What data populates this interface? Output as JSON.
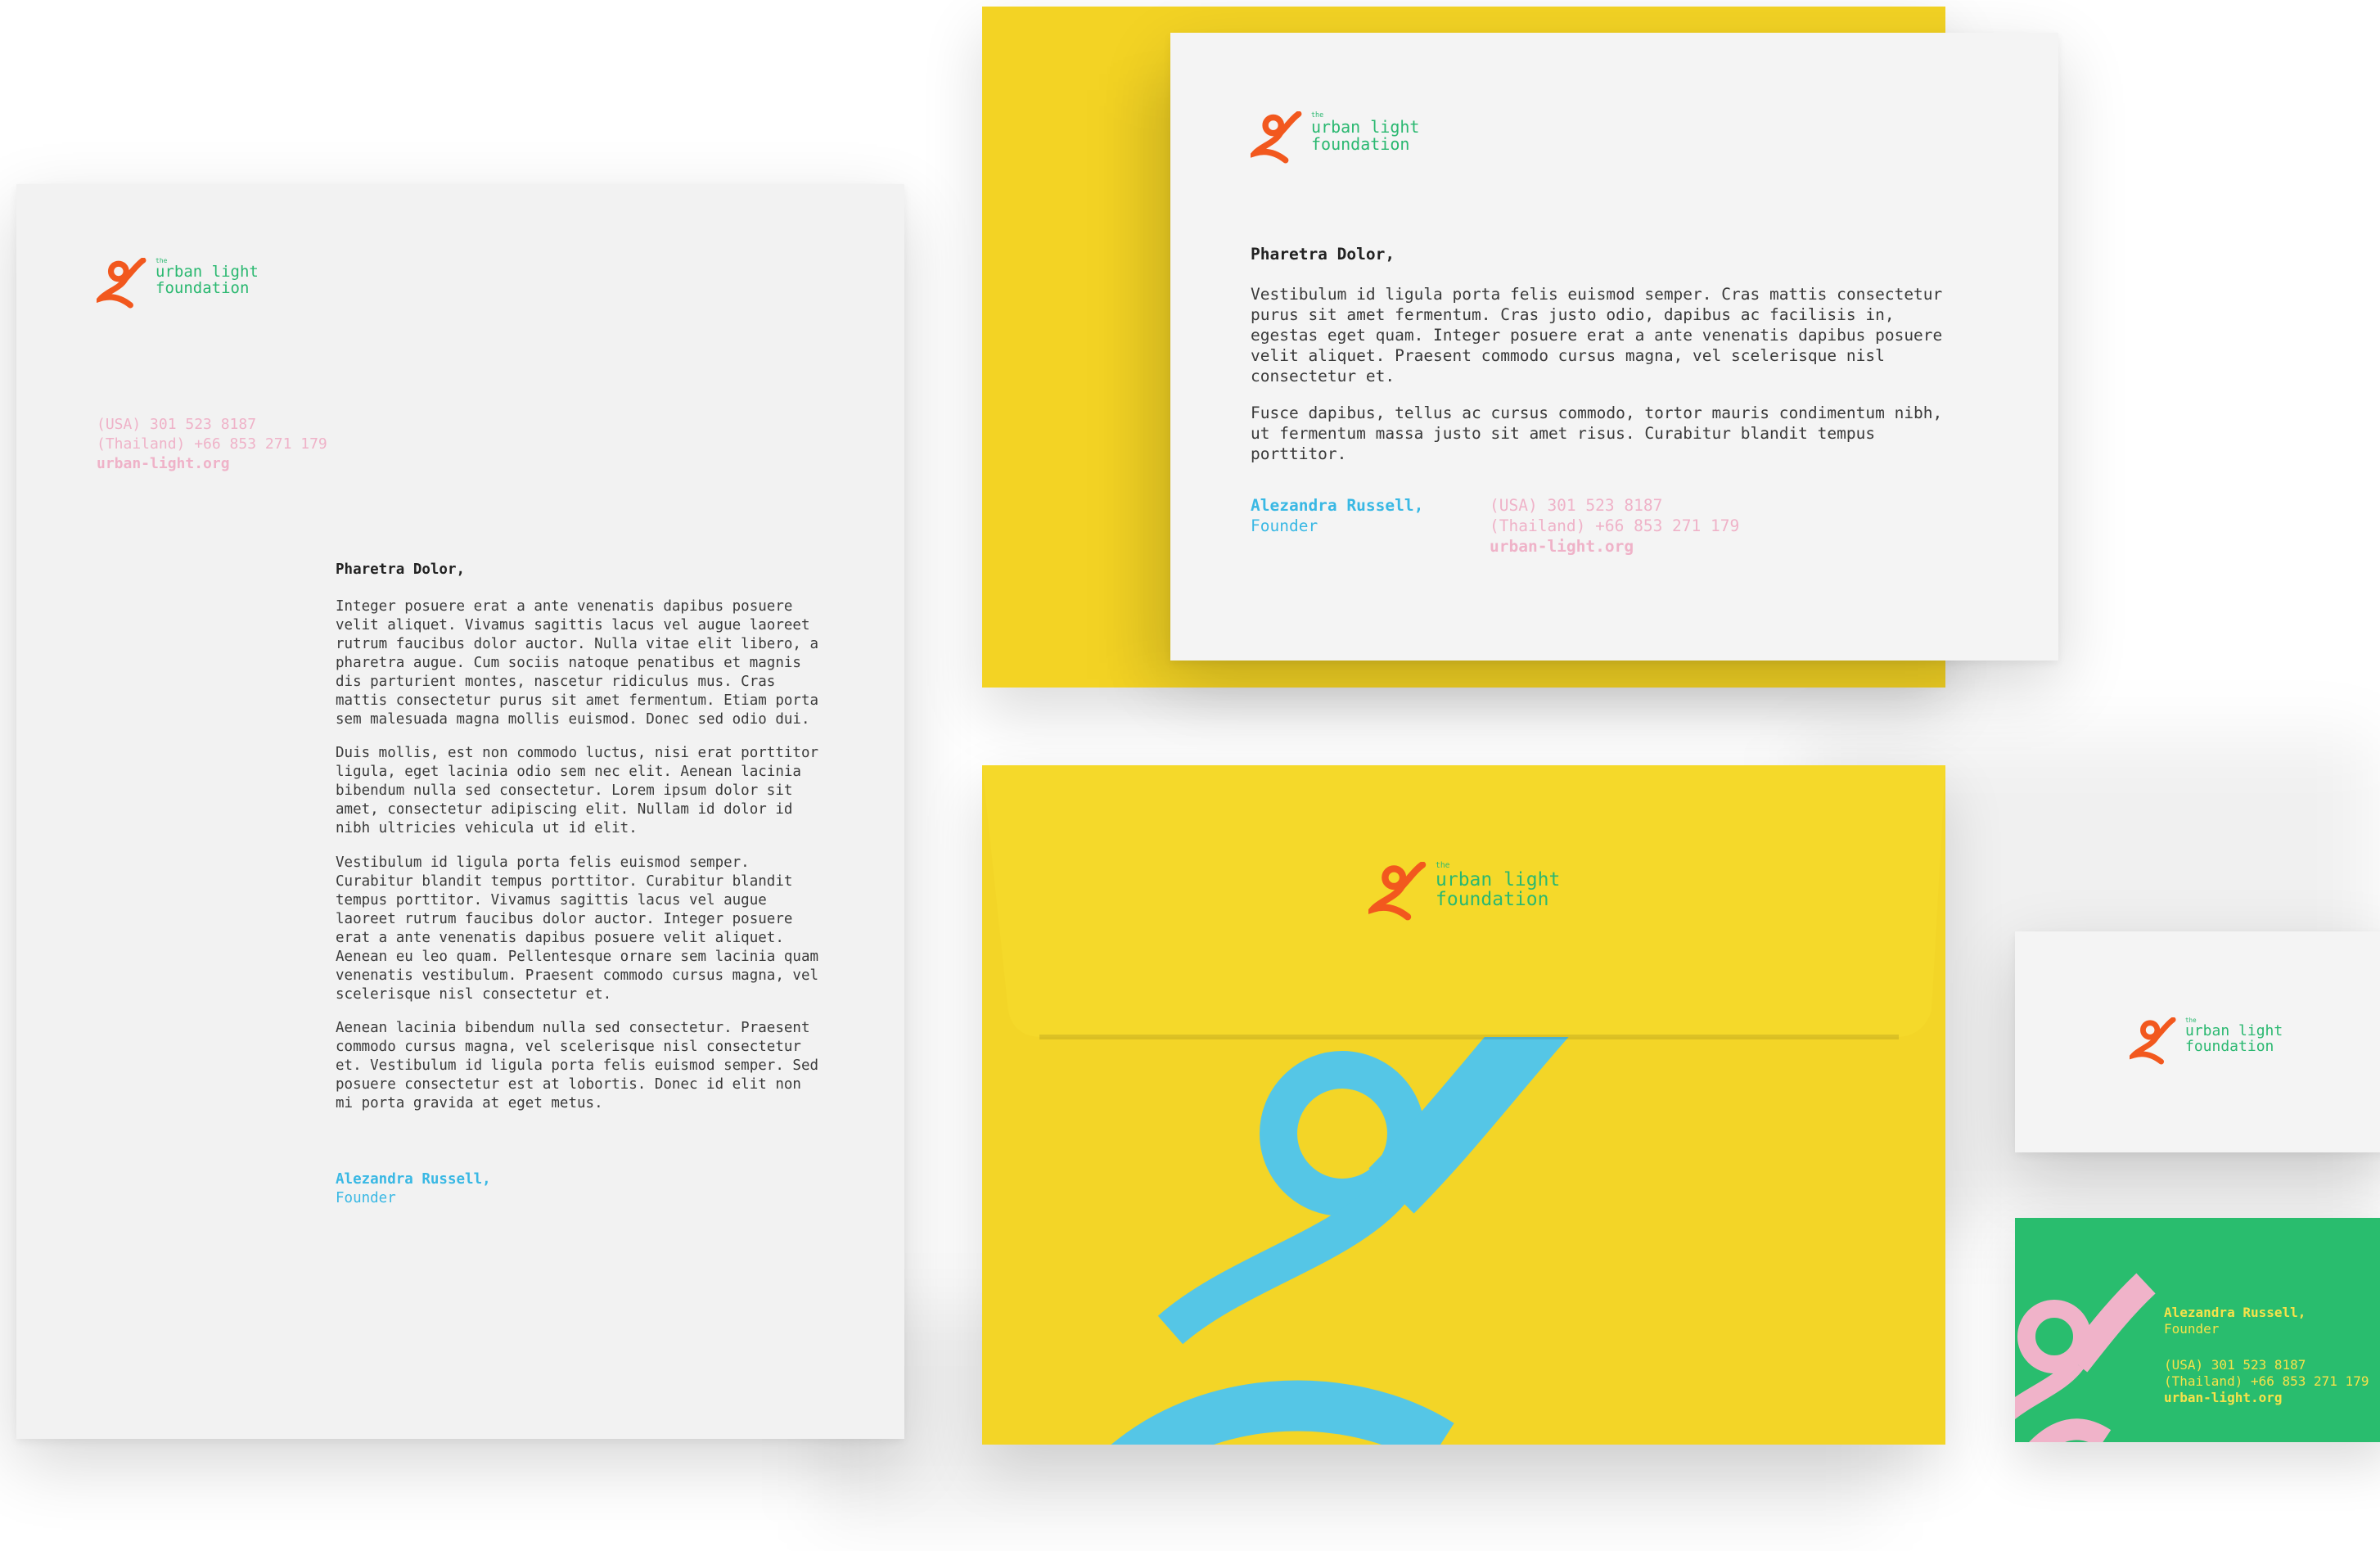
{
  "brand": {
    "the": "the",
    "line1": "urban light",
    "line2": "foundation",
    "colors": {
      "orange": "#f2581e",
      "green": "#2ab870",
      "yellow": "#f5d928",
      "sky": "#55c6e6",
      "pink": "#f0b3c9",
      "card_green": "#29bd6e"
    },
    "mark_icon": "running-figure-logo-icon"
  },
  "contact": {
    "usa": "(USA) 301 523 8187",
    "thailand": "(Thailand) +66 853 271 179",
    "web": "urban-light.org"
  },
  "letterhead": {
    "salutation": "Pharetra Dolor,",
    "paragraphs": [
      "Integer posuere erat a ante venenatis dapibus posuere velit aliquet. Vivamus sagittis lacus vel augue laoreet rutrum faucibus dolor auctor. Nulla vitae elit libero, a pharetra augue. Cum sociis natoque penatibus et magnis dis parturient montes, nascetur ridiculus mus. Cras mattis consectetur purus sit amet fermentum. Etiam porta sem malesuada magna mollis euismod. Donec sed odio dui.",
      "Duis mollis, est non commodo luctus, nisi erat porttitor ligula, eget lacinia odio sem nec elit. Aenean lacinia bibendum nulla sed consectetur. Lorem ipsum dolor sit amet, consectetur adipiscing elit. Nullam id dolor id nibh ultricies vehicula ut id elit.",
      "Vestibulum id ligula porta felis euismod semper. Curabitur blandit tempus porttitor. Curabitur blandit tempus porttitor. Vivamus sagittis lacus vel augue laoreet rutrum faucibus dolor auctor. Integer posuere erat a ante venenatis dapibus posuere velit aliquet. Aenean eu leo quam. Pellentesque ornare sem lacinia quam venenatis vestibulum. Praesent commodo cursus magna, vel scelerisque nisl consectetur et.",
      "Aenean lacinia bibendum nulla sed consectetur. Praesent commodo cursus magna, vel scelerisque nisl consectetur et. Vestibulum id ligula porta felis euismod semper. Sed posuere consectetur est at lobortis. Donec id elit non mi porta gravida at eget metus."
    ],
    "signature_name": "Alezandra Russell,",
    "signature_role": "Founder"
  },
  "card_note": {
    "salutation": "Pharetra Dolor,",
    "paragraphs": [
      "Vestibulum id ligula porta felis euismod semper. Cras mattis consectetur purus sit amet fermentum. Cras justo odio, dapibus ac facilisis in, egestas eget quam. Integer posuere erat a ante venenatis dapibus posuere velit aliquet. Praesent commodo cursus magna, vel scelerisque nisl consectetur et.",
      "Fusce dapibus, tellus ac cursus commodo, tortor mauris condimentum nibh, ut fermentum massa justo sit amet risus. Curabitur blandit tempus porttitor."
    ],
    "signature_name": "Alezandra Russell,",
    "signature_role": "Founder"
  },
  "business_card": {
    "name": "Alezandra Russell,",
    "role": "Founder"
  }
}
